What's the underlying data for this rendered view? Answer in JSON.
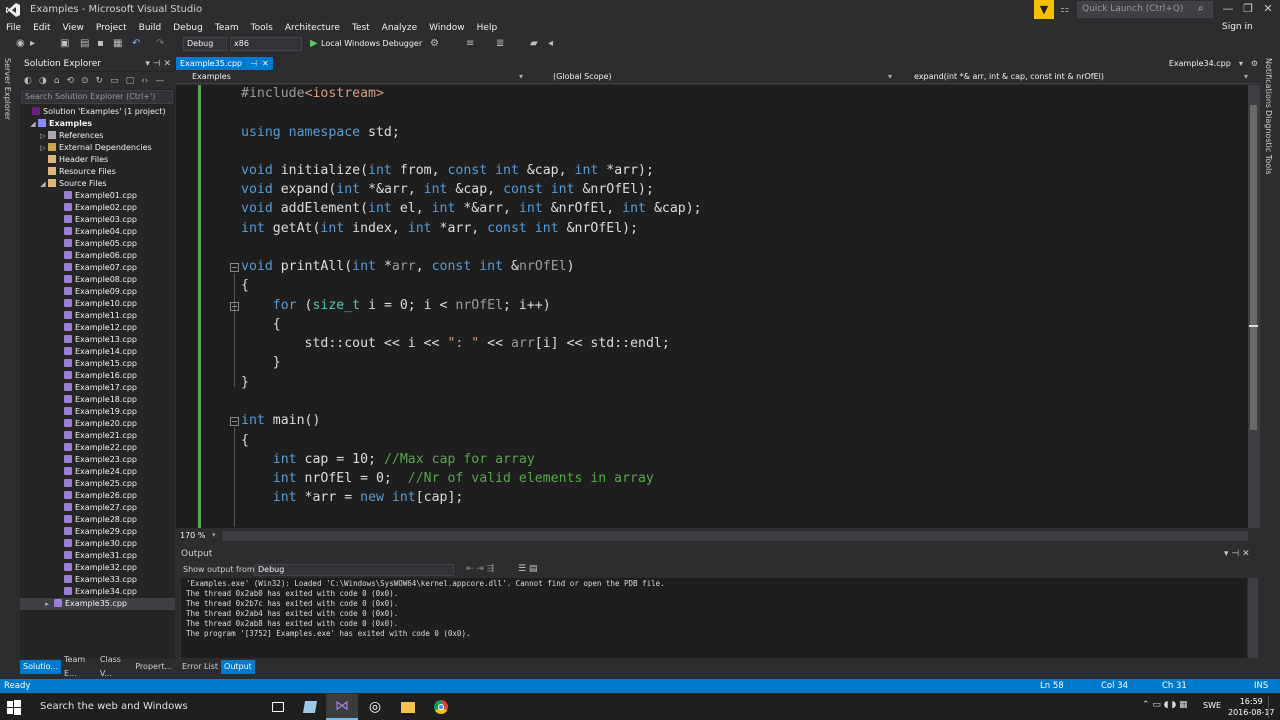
{
  "window": {
    "title": "Examples - Microsoft Visual Studio"
  },
  "quick_launch": {
    "placeholder": "Quick Launch (Ctrl+Q)"
  },
  "signin_label": "Sign in",
  "menu": [
    "File",
    "Edit",
    "View",
    "Project",
    "Build",
    "Debug",
    "Team",
    "Tools",
    "Architecture",
    "Test",
    "Analyze",
    "Window",
    "Help"
  ],
  "toolbar": {
    "config": "Debug",
    "platform": "x86",
    "start_label": "Local Windows Debugger"
  },
  "left_strip_label": "Server Explorer",
  "solution_explorer": {
    "title": "Solution Explorer",
    "search_placeholder": "Search Solution Explorer (Ctrl+')",
    "solution": "Solution 'Examples' (1 project)",
    "project": "Examples",
    "folders": [
      "References",
      "External Dependencies",
      "Header Files",
      "Resource Files",
      "Source Files"
    ],
    "files": [
      "Example01.cpp",
      "Example02.cpp",
      "Example03.cpp",
      "Example04.cpp",
      "Example05.cpp",
      "Example06.cpp",
      "Example07.cpp",
      "Example08.cpp",
      "Example09.cpp",
      "Example10.cpp",
      "Example11.cpp",
      "Example12.cpp",
      "Example13.cpp",
      "Example14.cpp",
      "Example15.cpp",
      "Example16.cpp",
      "Example17.cpp",
      "Example18.cpp",
      "Example19.cpp",
      "Example20.cpp",
      "Example21.cpp",
      "Example22.cpp",
      "Example23.cpp",
      "Example24.cpp",
      "Example25.cpp",
      "Example26.cpp",
      "Example27.cpp",
      "Example28.cpp",
      "Example29.cpp",
      "Example30.cpp",
      "Example31.cpp",
      "Example32.cpp",
      "Example33.cpp",
      "Example34.cpp",
      "Example35.cpp"
    ],
    "selected_file": "Example35.cpp"
  },
  "left_bottom_tabs": [
    "Solutio...",
    "Team E...",
    "Class V...",
    "Propert..."
  ],
  "editor": {
    "active_tab": "Example35.cpp",
    "tab_pin": "⊣",
    "right_tab": "Example34.cpp",
    "nav_project": "Examples",
    "nav_scope": "(Global Scope)",
    "nav_member": "expand(int *& arr, int & cap, const int & nrOfEl)",
    "zoom": "170 %"
  },
  "code_lines": [
    "#include<iostream>",
    "",
    "using namespace std;",
    "",
    "void initialize(int from, const int &cap, int *arr);",
    "void expand(int *&arr, int &cap, const int &nrOfEl);",
    "void addElement(int el, int *&arr, int &nrOfEl, int &cap);",
    "int getAt(int index, int *arr, const int &nrOfEl);",
    "",
    "void printAll(int *arr, const int &nrOfEl)",
    "{",
    "    for (size_t i = 0; i < nrOfEl; i++)",
    "    {",
    "        std::cout << i << \": \" << arr[i] << std::endl;",
    "    }",
    "}",
    "",
    "int main()",
    "{",
    "    int cap = 10; //Max cap for array",
    "    int nrOfEl = 0;  //Nr of valid elements in array",
    "    int *arr = new int[cap];"
  ],
  "output": {
    "title": "Output",
    "show_from_label": "Show output from:",
    "source": "Debug",
    "lines": [
      "'Examples.exe' (Win32): Loaded 'C:\\Windows\\SysWOW64\\kernel.appcore.dll'. Cannot find or open the PDB file.",
      "The thread 0x2ab0 has exited with code 0 (0x0).",
      "The thread 0x2b7c has exited with code 0 (0x0).",
      "The thread 0x2ab4 has exited with code 0 (0x0).",
      "The thread 0x2ab8 has exited with code 0 (0x0).",
      "The program '[3752] Examples.exe' has exited with code 0 (0x0)."
    ]
  },
  "bottom_tabs": [
    "Error List",
    "Output"
  ],
  "right_strip": [
    "Notifications",
    "Diagnostic Tools"
  ],
  "status": {
    "state": "Ready",
    "ln": "Ln 58",
    "col": "Col 34",
    "ch": "Ch 31",
    "mode": "INS"
  },
  "taskbar": {
    "search": "Search the web and Windows",
    "lang": "SWE",
    "time": "16:59",
    "date": "2016-08-17"
  },
  "colors": {
    "accent": "#007acc",
    "keyword": "#569cd6",
    "type": "#4ec9b0",
    "string": "#d69d85",
    "comment": "#57a64a"
  }
}
